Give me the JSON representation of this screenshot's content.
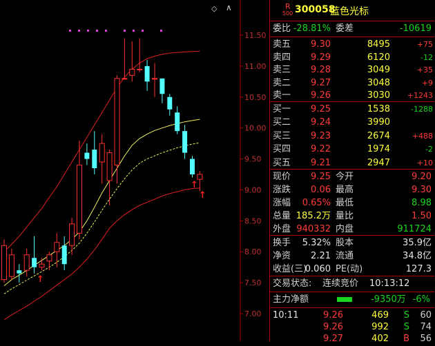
{
  "chart": {
    "price_ticks": [
      "11.50",
      "11.00",
      "10.50",
      "10.00",
      "9.50",
      "9.00",
      "8.50",
      "8.00",
      "7.50",
      "7.00"
    ],
    "markers": [
      "↑",
      "↑",
      "↑",
      "↑"
    ],
    "corner_icon": "diamond-icon"
  },
  "chart_data": {
    "type": "candlestick",
    "ylim": [
      6.9,
      11.75
    ],
    "candles": [
      {
        "o": 7.55,
        "c": 8.1,
        "h": 8.2,
        "l": 7.5
      },
      {
        "o": 7.6,
        "c": 7.95,
        "h": 8.05,
        "l": 7.55
      },
      {
        "o": 7.7,
        "c": 7.65,
        "h": 7.8,
        "l": 7.5
      },
      {
        "o": 7.7,
        "c": 7.95,
        "h": 8.05,
        "l": 7.6
      },
      {
        "o": 7.9,
        "c": 7.75,
        "h": 8.25,
        "l": 7.65
      },
      {
        "o": 7.75,
        "c": 7.8,
        "h": 7.9,
        "l": 7.7
      },
      {
        "o": 7.85,
        "c": 7.95,
        "h": 8.0,
        "l": 7.7
      },
      {
        "o": 8.0,
        "c": 8.15,
        "h": 8.3,
        "l": 7.75
      },
      {
        "o": 8.1,
        "c": 7.8,
        "h": 8.25,
        "l": 7.7
      },
      {
        "o": 8.1,
        "c": 8.45,
        "h": 8.55,
        "l": 7.95
      },
      {
        "o": 8.3,
        "c": 9.4,
        "h": 9.8,
        "l": 8.2
      },
      {
        "o": 9.6,
        "c": 9.5,
        "h": 9.75,
        "l": 9.4
      },
      {
        "o": 9.65,
        "c": 9.35,
        "h": 9.95,
        "l": 9.25
      },
      {
        "o": 9.45,
        "c": 9.75,
        "h": 9.9,
        "l": 9.1
      },
      {
        "o": 9.15,
        "c": 9.6,
        "h": 9.65,
        "l": 8.75
      },
      {
        "o": 9.4,
        "c": 10.8,
        "h": 10.85,
        "l": 9.1
      },
      {
        "o": 10.8,
        "c": 10.8,
        "h": 11.45,
        "l": 10.8
      },
      {
        "o": 10.85,
        "c": 10.95,
        "h": 11.4,
        "l": 10.75
      },
      {
        "o": 10.95,
        "c": 10.95,
        "h": 11.45,
        "l": 10.9
      },
      {
        "o": 11.0,
        "c": 10.75,
        "h": 11.1,
        "l": 10.6
      },
      {
        "o": 10.8,
        "c": 10.8,
        "h": 11.05,
        "l": 10.5
      },
      {
        "o": 10.8,
        "c": 10.55,
        "h": 10.8,
        "l": 10.4
      },
      {
        "o": 10.5,
        "c": 10.3,
        "h": 10.55,
        "l": 10.2
      },
      {
        "o": 10.25,
        "c": 9.95,
        "h": 10.35,
        "l": 9.9
      },
      {
        "o": 9.95,
        "c": 9.6,
        "h": 10.05,
        "l": 9.5
      },
      {
        "o": 9.5,
        "c": 9.25,
        "h": 9.55,
        "l": 9.2
      },
      {
        "o": 9.17,
        "c": 9.25,
        "h": 9.3,
        "l": 8.98
      }
    ],
    "bands": {
      "upper": [
        8.0,
        8.12,
        8.25,
        8.4,
        8.55,
        8.7,
        8.88,
        9.05,
        9.25,
        9.45,
        9.65,
        9.85,
        10.05,
        10.25,
        10.45,
        10.65,
        10.82,
        10.95,
        11.05,
        11.12,
        11.16,
        11.19,
        11.21,
        11.22,
        11.23,
        11.235,
        11.24
      ],
      "middle": [
        7.45,
        7.55,
        7.62,
        7.7,
        7.78,
        7.86,
        7.94,
        8.02,
        8.1,
        8.2,
        8.32,
        8.5,
        8.72,
        8.95,
        9.15,
        9.35,
        9.55,
        9.72,
        9.83,
        9.9,
        9.96,
        10.0,
        10.04,
        10.07,
        10.1,
        10.12,
        10.14
      ],
      "ma_dashed": [
        7.32,
        7.4,
        7.47,
        7.54,
        7.61,
        7.68,
        7.75,
        7.83,
        7.92,
        8.02,
        8.14,
        8.3,
        8.48,
        8.67,
        8.85,
        9.02,
        9.18,
        9.32,
        9.43,
        9.5,
        9.55,
        9.6,
        9.64,
        9.68,
        9.71,
        9.74,
        9.76
      ],
      "lower": [
        6.9,
        6.98,
        7.05,
        7.12,
        7.2,
        7.28,
        7.37,
        7.46,
        7.55,
        7.64,
        7.75,
        7.88,
        8.03,
        8.2,
        8.38,
        8.5,
        8.6,
        8.68,
        8.75,
        8.8,
        8.85,
        8.9,
        8.94,
        8.97,
        9.0,
        9.02,
        9.03
      ]
    }
  },
  "header": {
    "r_label": "R",
    "r_sub": "500",
    "code": "300058",
    "name": "蓝色光标"
  },
  "weibi": {
    "l1": "委比",
    "v1": "-28.81%",
    "l2": "委差",
    "v2": "-10619"
  },
  "sells": [
    {
      "label": "卖五",
      "price": "9.30",
      "vol": "8495",
      "chg": "+75"
    },
    {
      "label": "卖四",
      "price": "9.29",
      "vol": "6120",
      "chg": "-12"
    },
    {
      "label": "卖三",
      "price": "9.28",
      "vol": "3049",
      "chg": "+35"
    },
    {
      "label": "卖二",
      "price": "9.27",
      "vol": "3048",
      "chg": "+9"
    },
    {
      "label": "卖一",
      "price": "9.26",
      "vol": "3030",
      "chg": "+1243"
    }
  ],
  "buys": [
    {
      "label": "买一",
      "price": "9.25",
      "vol": "1538",
      "chg": "-1288"
    },
    {
      "label": "买二",
      "price": "9.24",
      "vol": "3990",
      "chg": ""
    },
    {
      "label": "买三",
      "price": "9.23",
      "vol": "2674",
      "chg": "+488"
    },
    {
      "label": "买四",
      "price": "9.22",
      "vol": "1974",
      "chg": "-2"
    },
    {
      "label": "买五",
      "price": "9.21",
      "vol": "2947",
      "chg": "+10"
    }
  ],
  "stats1": [
    {
      "l1": "现价",
      "v1": "9.25",
      "l2": "今开",
      "v2": "9.20"
    },
    {
      "l1": "涨跌",
      "v1": "0.06",
      "l2": "最高",
      "v2": "9.30"
    },
    {
      "l1": "涨幅",
      "v1": "0.65%",
      "l2": "最低",
      "v2": "8.98"
    },
    {
      "l1": "总量",
      "v1": "185.2万",
      "l2": "量比",
      "v2": "1.50"
    },
    {
      "l1": "外盘",
      "v1": "940332",
      "l2": "内盘",
      "v2": "911724"
    }
  ],
  "stats2": [
    {
      "l1": "换手",
      "v1": "5.32%",
      "l2": "股本",
      "v2": "35.9亿"
    },
    {
      "l1": "净资",
      "v1": "2.21",
      "l2": "流通",
      "v2": "34.8亿"
    },
    {
      "l1": "收益(三)",
      "v1": "0.060",
      "l2": "PE(动)",
      "v2": "127.3"
    }
  ],
  "status": {
    "label": "交易状态:",
    "value": "连续竞价",
    "time": "10:13:12"
  },
  "flow": {
    "label": "主力净额",
    "value": "-9350万",
    "pct": "-6%"
  },
  "ticks": [
    {
      "time": "10:11",
      "price": "9.26",
      "vol": "469",
      "side": "S",
      "count": "60"
    },
    {
      "time": "",
      "price": "9.26",
      "vol": "992",
      "side": "S",
      "count": "74"
    },
    {
      "time": "",
      "price": "9.27",
      "vol": "402",
      "side": "B",
      "count": "56"
    }
  ]
}
